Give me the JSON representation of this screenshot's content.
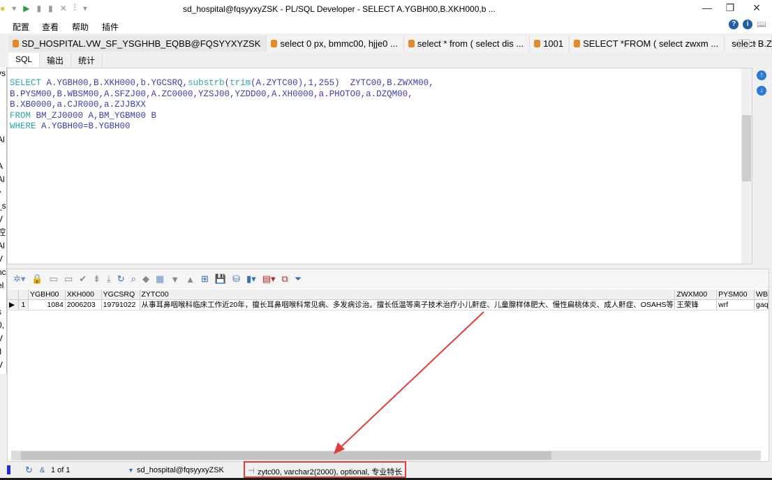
{
  "window": {
    "title": "sd_hospital@fqsyyxyZSK - PL/SQL Developer - SELECT A.YGBH00,B.XKH000,b ...",
    "minimize": "—",
    "restore": "❐",
    "close": "✕"
  },
  "menu": [
    "配置",
    "查看",
    "帮助",
    "插件"
  ],
  "help_icons": [
    "?",
    "i",
    "📖"
  ],
  "tabs": [
    {
      "label": "SD_HOSPITAL.VW_SF_YSGHHB_EQBB@FQSYYXYZSK"
    },
    {
      "label": "select 0 px, bmmc00, hjje0 ..."
    },
    {
      "label": "select * from ( select dis ..."
    },
    {
      "label": "1001"
    },
    {
      "label": "SELECT *FROM ( select zwxm ..."
    },
    {
      "label": "select B.ZWX"
    }
  ],
  "tab_nav": [
    "⌄",
    "‹",
    "›"
  ],
  "subtabs": [
    "SQL",
    "输出",
    "统计"
  ],
  "left_fragments": [
    "ys",
    "",
    "",
    "",
    "",
    "Al",
    "f",
    "A",
    "Al",
    "^",
    "_s",
    "V",
    "腔",
    "Al",
    "V",
    "nc",
    "el",
    "",
    "s",
    "0,",
    "V",
    ".l",
    "V",
    "0"
  ],
  "sql": {
    "lines": [
      [
        {
          "k": 1,
          "t": "SELECT"
        },
        {
          "k": 0,
          "t": " A.YGBH00,B.XKH000,b.YGCSRQ,"
        },
        {
          "k": 1,
          "t": "substrb"
        },
        {
          "k": 0,
          "t": "("
        },
        {
          "k": 1,
          "t": "trim"
        },
        {
          "k": 0,
          "t": "(A.ZYTC00),1,255)  ZYTC00,B.ZWXM00,"
        }
      ],
      [
        {
          "k": 0,
          "t": "B.PYSM00,B.WBSM00,A.SFZJ00,A.ZC0000,YZSJ00,YZDD00,A.XH0000,a.PHOTO0,a.DZQM00,"
        }
      ],
      [
        {
          "k": 0,
          "t": "B.XB0000,a.CJR000,a.ZJJBXX"
        }
      ],
      [
        {
          "k": 1,
          "t": "FROM"
        },
        {
          "k": 0,
          "t": " BM_ZJ0000 A,BM_YGBM00 B"
        }
      ],
      [
        {
          "k": 1,
          "t": "WHERE"
        },
        {
          "k": 0,
          "t": " A.YGBH00=B.YGBH00"
        }
      ]
    ]
  },
  "grid": {
    "columns": [
      "",
      "",
      "YGBH00",
      "XKH000",
      "YGCSRQ",
      "ZYTC00",
      "ZWXM00",
      "PYSM00",
      "WB"
    ],
    "rows": [
      [
        "▶",
        "1",
        "1084",
        "2006203",
        "19791022",
        "从事耳鼻咽喉科临床工作近20年，擅长耳鼻咽喉科常见病、多发病诊治。擅长低温等离子技术治疗小儿鼾症、儿童腺样体肥大、慢性扁桃体炎、成人鼾症、OSAHS等；擅",
        "王荣锋",
        "wrf",
        "gaq"
      ]
    ]
  },
  "status": {
    "record": "1 of 1",
    "connection": "sd_hospital@fqsyyxyZSK",
    "field_info": "zytc00, varchar2(2000), optional, 专业特长"
  },
  "colors": {
    "annotation": "#e53b3b",
    "keyword": "#2aa8a8",
    "identifier": "#4040b0"
  }
}
